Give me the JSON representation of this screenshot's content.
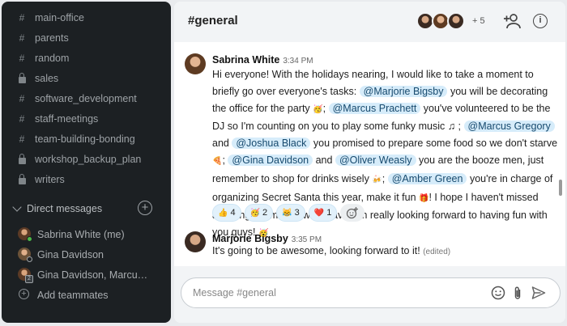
{
  "sidebar": {
    "channels": [
      {
        "name": "main-office",
        "icon": "hash-icon"
      },
      {
        "name": "parents",
        "icon": "hash-icon"
      },
      {
        "name": "random",
        "icon": "hash-icon"
      },
      {
        "name": "sales",
        "icon": "lock-icon"
      },
      {
        "name": "software_development",
        "icon": "hash-icon"
      },
      {
        "name": "staff-meetings",
        "icon": "hash-icon"
      },
      {
        "name": "team-building-bonding",
        "icon": "hash-icon"
      },
      {
        "name": "workshop_backup_plan",
        "icon": "lock-icon"
      },
      {
        "name": "writers",
        "icon": "lock-icon"
      }
    ],
    "dm_header": "Direct messages",
    "direct_messages": [
      {
        "name": "Sabrina White (me)",
        "status": "online"
      },
      {
        "name": "Gina Davidson",
        "status": "online"
      },
      {
        "name": "Gina Davidson, Marcus G...",
        "status": "group",
        "count": "2"
      }
    ],
    "add_teammates": "Add teammates"
  },
  "header": {
    "channel": "#general",
    "member_overflow": "+ 5"
  },
  "messages": [
    {
      "author": "Sabrina White",
      "time": "3:34 PM",
      "text": {
        "t1": "Hi everyone! With the holidays nearing, I would like to take a moment to briefly go over everyone's tasks:",
        "m1": "@Marjorie Bigsby",
        "t2": "you will be decorating the office for the party",
        "t3": ";",
        "m2": "@Marcus Prachett",
        "t4": "you've volunteered to be the DJ so I'm counting on you to play some funky music ♫ ;",
        "m3": "@Marcus Gregory",
        "t5": "and",
        "m4": "@Joshua Black",
        "t6": "you promised to prepare some food so we don't starve",
        "t7": ";",
        "m5": "@Gina Davidson",
        "t8": "and",
        "m6": "@Oliver Weasly",
        "t9": "you are the booze men, just remember to shop for drinks wisely",
        "t10": ";",
        "m7": "@Amber Green",
        "t11": "you're in charge of organizing Secret Santa this year, make it fun",
        "t12": "! I hope I haven't missed anything, let me know if I have! I'm really looking forward to having fun with you guys!"
      },
      "reactions": [
        {
          "emoji": "👍",
          "count": "4"
        },
        {
          "emoji": "🥳",
          "count": "2"
        },
        {
          "emoji": "😹",
          "count": "3"
        },
        {
          "emoji": "❤️",
          "count": "1"
        }
      ]
    },
    {
      "author": "Marjorie Bigsby",
      "time": "3:35 PM",
      "text": "It's going to be awesome, looking forward to it!",
      "edited": "(edited)"
    }
  ],
  "composer": {
    "placeholder": "Message #general"
  },
  "colors": {
    "sidebar_bg": "#1c2023",
    "mention_bg": "#d6ecfa",
    "online": "#4cbb4a"
  }
}
